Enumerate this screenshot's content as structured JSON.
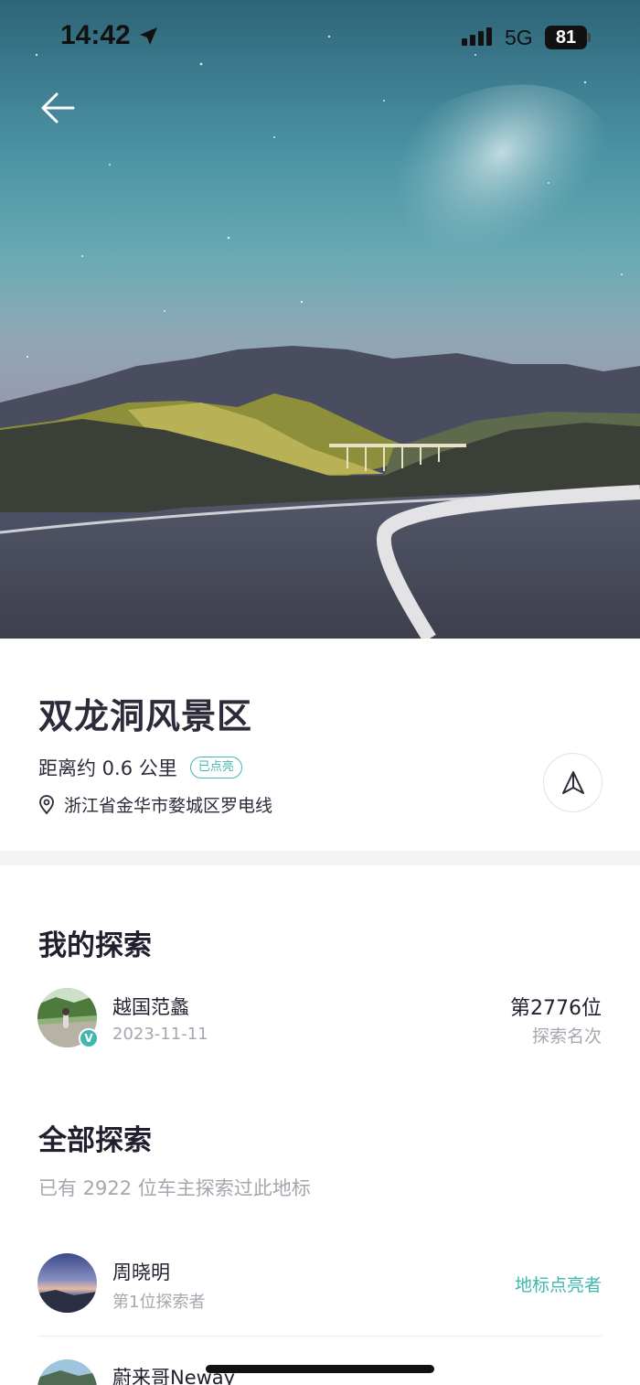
{
  "status_bar": {
    "time": "14:42",
    "network": "5G",
    "battery": "81"
  },
  "place": {
    "name": "双龙洞风景区",
    "distance": "距离约 0.6 公里",
    "badge": "已点亮",
    "address": "浙江省金华市婺城区罗电线"
  },
  "my_exploration": {
    "title": "我的探索",
    "user": {
      "name": "越国范蠡",
      "date": "2023-11-11",
      "verified_mark": "V"
    },
    "rank": "第2776位",
    "rank_label": "探索名次"
  },
  "all_exploration": {
    "title": "全部探索",
    "count_text": "已有 2922 位车主探索过此地标",
    "explorers": [
      {
        "name": "周晓明",
        "subtitle": "第1位探索者",
        "tag": "地标点亮者"
      },
      {
        "name": "蔚来哥Neway",
        "subtitle": "",
        "tag": ""
      }
    ]
  },
  "icons": {
    "back": "arrow-left-icon",
    "location": "location-arrow-icon",
    "pin": "map-pin-icon",
    "navigate": "navigation-arrow-icon",
    "signal": "cellular-signal-icon"
  },
  "colors": {
    "accent": "#3fb8b0",
    "title": "#2b2b3a",
    "muted": "#a6a6ae"
  }
}
